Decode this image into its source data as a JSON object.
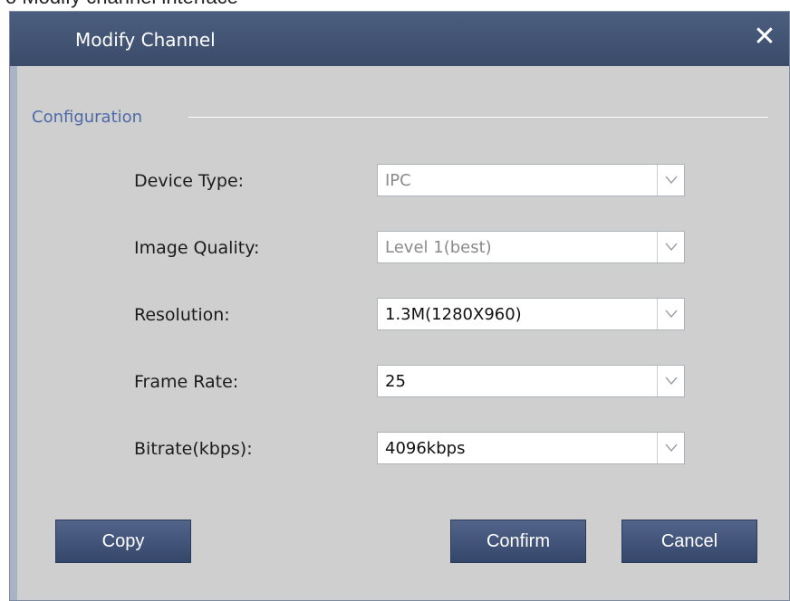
{
  "top_partial_text": "o Modify channel interface",
  "dialog": {
    "title": "Modify Channel",
    "close_icon": "close-icon"
  },
  "configuration": {
    "section_label": "Configuration",
    "rows": [
      {
        "label": "Device Type:",
        "value": "IPC",
        "disabled": true
      },
      {
        "label": "Image Quality:",
        "value": "Level 1(best)",
        "disabled": true
      },
      {
        "label": "Resolution:",
        "value": "1.3M(1280X960)",
        "disabled": false
      },
      {
        "label": "Frame Rate:",
        "value": "25",
        "disabled": false
      },
      {
        "label": "Bitrate(kbps):",
        "value": "4096kbps",
        "disabled": false
      }
    ]
  },
  "buttons": {
    "copy": "Copy",
    "confirm": "Confirm",
    "cancel": "Cancel"
  },
  "colors": {
    "titlebar": "#3f5172",
    "body_bg": "#cfcfcf",
    "section_label": "#4d6aa7",
    "button": "#3e5075"
  }
}
